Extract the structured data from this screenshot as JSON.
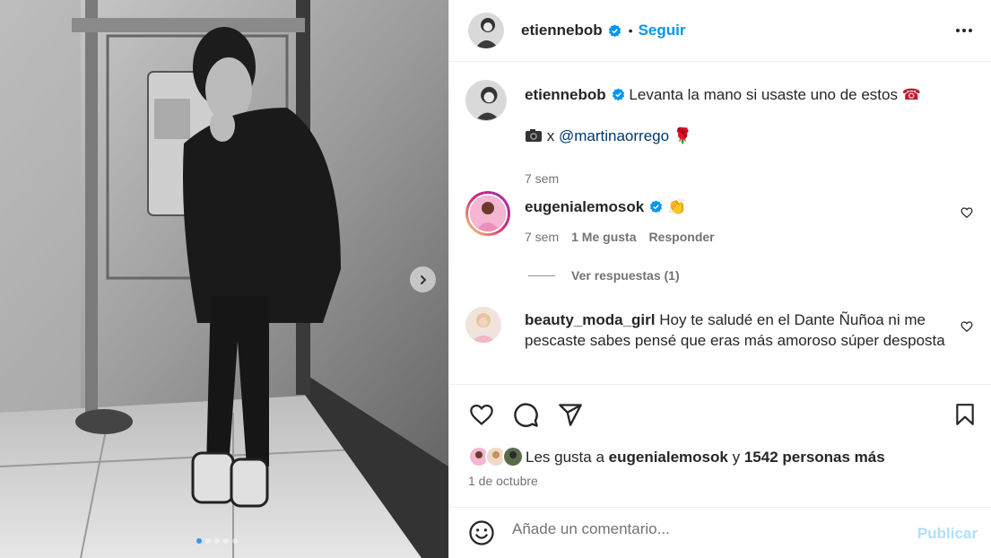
{
  "post": {
    "carousel": {
      "slide_count": 5,
      "active_slide": 1
    },
    "author": {
      "username": "etiennebob",
      "verified": true,
      "follow_label": "Seguir"
    },
    "caption": {
      "username": "etiennebob",
      "text": "Levanta la mano si usaste uno de estos",
      "emoji": "☎",
      "credit_prefix": "x",
      "mention": "@martinaorrego",
      "credit_emoji": "🌹",
      "time": "7 sem"
    },
    "comments": [
      {
        "username": "eugenialemosok",
        "verified": true,
        "text": "👏",
        "time": "7 sem",
        "likes": "1 Me gusta",
        "reply_label": "Responder",
        "view_replies": "Ver respuestas (1)"
      },
      {
        "username": "beauty_moda_girl",
        "verified": false,
        "text": "Hoy te saludé en el Dante Ñuñoa ni me pescaste sabes pensé que eras más amoroso súper desposta"
      }
    ],
    "likes": {
      "prefix": "Les gusta a",
      "user": "eugenialemosok",
      "connector": "y",
      "others": "1542 personas más"
    },
    "date": "1 de octubre",
    "add_comment": {
      "placeholder": "Añade un comentario...",
      "publish_label": "Publicar"
    },
    "colors": {
      "accent": "#0095f6",
      "verified": "#0095f6",
      "publish_disabled": "#b2dffc",
      "active_dot": "#3897f0"
    }
  }
}
